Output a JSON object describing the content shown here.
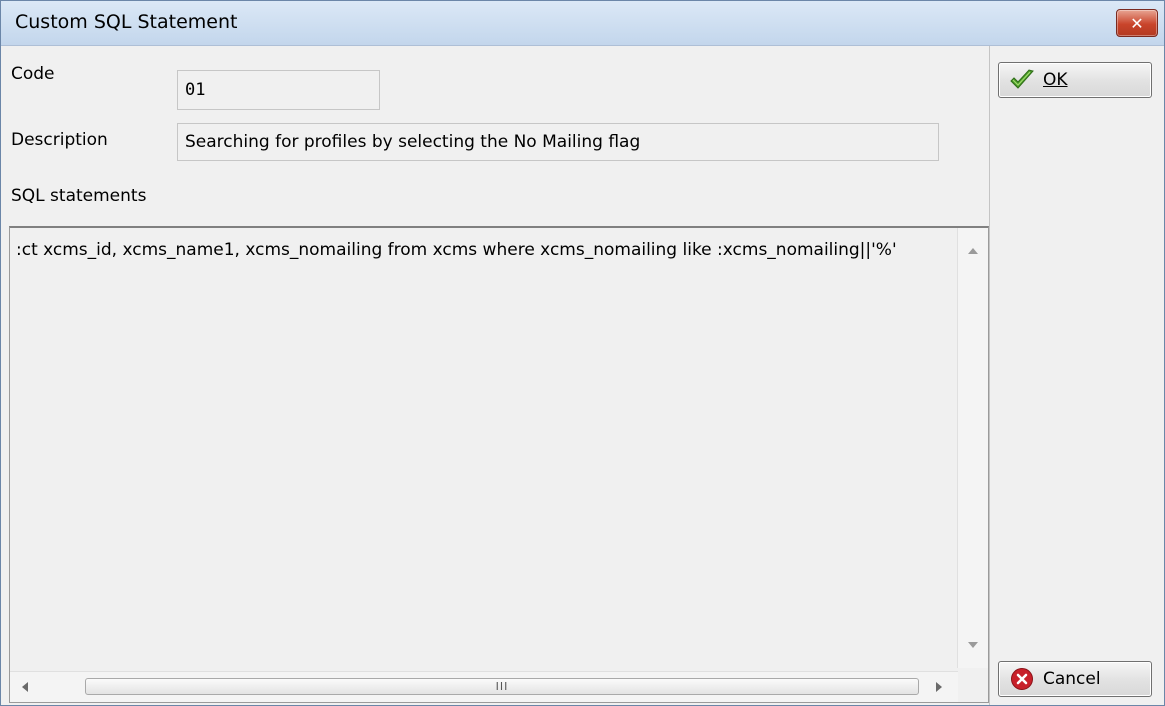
{
  "window": {
    "title": "Custom SQL Statement",
    "close_glyph": "✕"
  },
  "form": {
    "code_label": "Code",
    "code_value": "01",
    "description_label": "Description",
    "description_value": "Searching for profiles by selecting the No Mailing flag",
    "sql_label": "SQL statements",
    "sql_value": ":ct xcms_id, xcms_name1, xcms_nomailing from xcms where xcms_nomailing like :xcms_nomailing||'%'",
    "hscroll_grip": "III"
  },
  "buttons": {
    "ok_label": "OK",
    "cancel_label": "Cancel"
  },
  "icons": {
    "ok": "checkmark-icon",
    "cancel": "cancel-x-icon",
    "close": "close-icon"
  },
  "colors": {
    "title_gradient_top": "#dbe8f6",
    "close_red": "#c9442b",
    "check_green": "#4a9a2a"
  }
}
